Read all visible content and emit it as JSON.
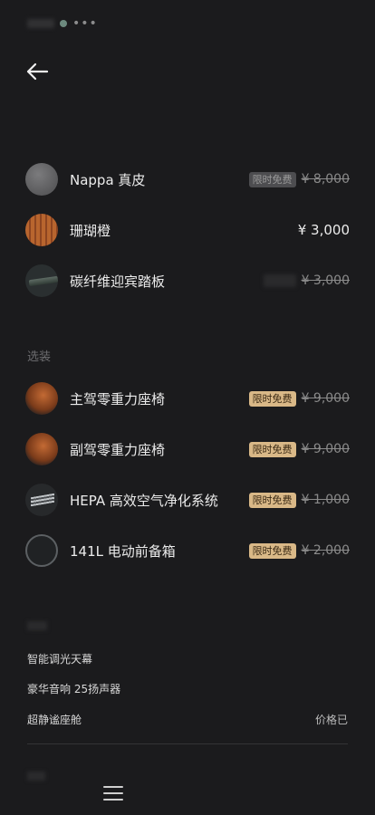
{
  "status_bar": {
    "dots": "•••"
  },
  "options": [
    {
      "name": "Nappa 真皮",
      "badge": "限时免费",
      "price": "¥ 8,000",
      "thumb": "nappa-leather",
      "state": "dim-badge"
    },
    {
      "name": "珊瑚橙",
      "price": "¥ 3,000",
      "thumb": "coral-orange"
    },
    {
      "name": "碳纤维迎宾踏板",
      "price": "¥ 3,000",
      "thumb": "carbon-sill"
    }
  ],
  "optional_section": {
    "label": "选装",
    "items": [
      {
        "name": "主驾零重力座椅",
        "badge": "限时免费",
        "price": "¥ 9,000",
        "thumb": "driver-seat"
      },
      {
        "name": "副驾零重力座椅",
        "badge": "限时免费",
        "price": "¥ 9,000",
        "thumb": "passenger-seat"
      },
      {
        "name": "HEPA 高效空气净化系统",
        "badge": "限时免费",
        "price": "¥ 1,000",
        "thumb": "hepa-filter"
      },
      {
        "name": "141L 电动前备箱",
        "badge": "限时免费",
        "price": "¥ 2,000",
        "thumb": "front-trunk"
      }
    ]
  },
  "standard_section": {
    "items": [
      {
        "name": "智能调光天幕"
      },
      {
        "name": "豪华音响 25扬声器"
      },
      {
        "name": "超静谧座舱",
        "right": "价格已"
      }
    ]
  },
  "colors": {
    "background": "#1b1b1d",
    "badge": "#d9b887",
    "strike_text": "#8a8a8a"
  }
}
